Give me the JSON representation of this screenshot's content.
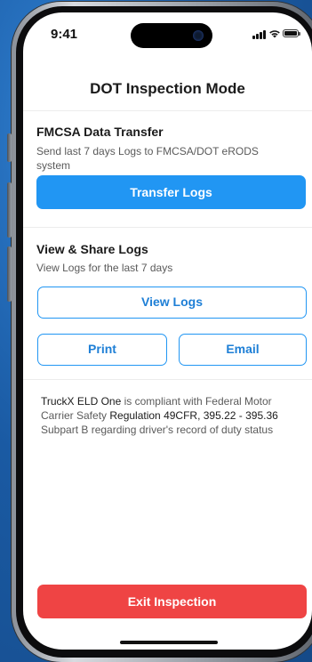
{
  "status_bar": {
    "time": "9:41"
  },
  "header": {
    "title": "DOT Inspection Mode"
  },
  "fmcsa": {
    "title": "FMCSA Data Transfer",
    "description": "Send last 7 days Logs to FMCSA/DOT eRODS system",
    "button_label": "Transfer Logs"
  },
  "view_share": {
    "title": "View & Share Logs",
    "description": "View Logs for the last 7 days",
    "view_button_label": "View Logs",
    "print_button_label": "Print",
    "email_button_label": "Email"
  },
  "compliance": {
    "brand": "TruckX ELD One",
    "text_part1": " is compliant with Federal Motor Carrier Safety ",
    "regulation": "Regulation 49CFR, 395.22 - 395.36",
    "text_part2": " Subpart B regarding driver's record of duty status"
  },
  "footer": {
    "exit_button_label": "Exit Inspection"
  },
  "colors": {
    "primary": "#2196f3",
    "danger": "#ef4444",
    "background": "#1d5fa8"
  }
}
